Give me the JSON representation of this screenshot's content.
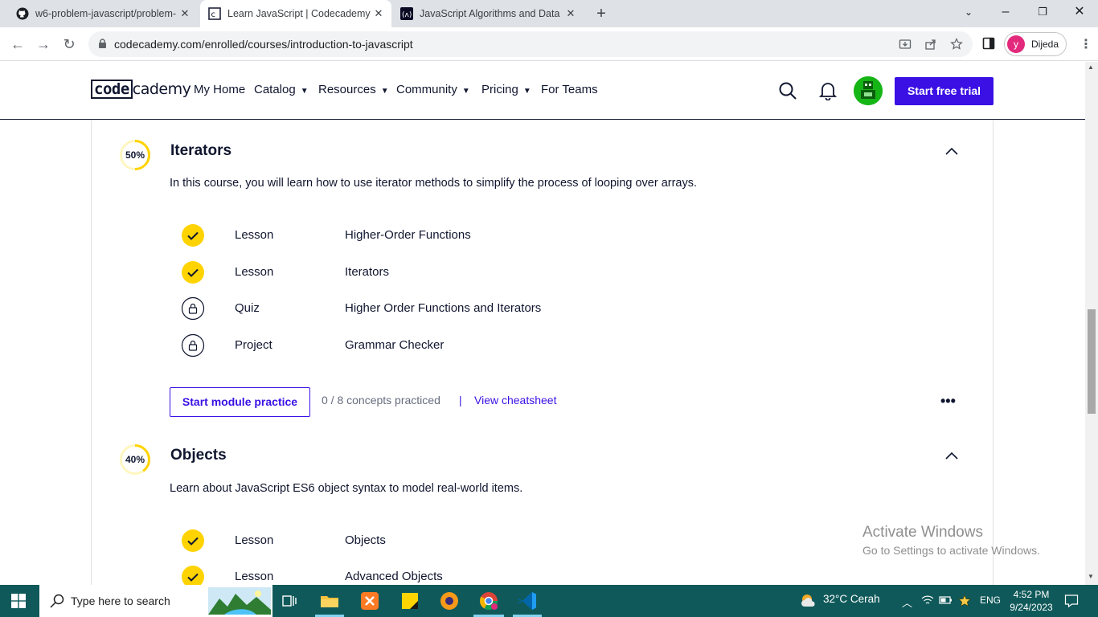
{
  "browser": {
    "tabs": [
      {
        "title": "w6-problem-javascript/problem-",
        "active": false
      },
      {
        "title": "Learn JavaScript | Codecademy",
        "active": true
      },
      {
        "title": "JavaScript Algorithms and Data S",
        "active": false
      }
    ],
    "url": "codecademy.com/enrolled/courses/introduction-to-javascript",
    "profile_initial": "y",
    "profile_name": "Dijeda"
  },
  "site": {
    "logo_left": "code",
    "logo_right": "cademy",
    "nav": [
      "My Home",
      "Catalog",
      "Resources",
      "Community",
      "Pricing",
      "For Teams"
    ],
    "cta": "Start free trial"
  },
  "modules": [
    {
      "progress": "50%",
      "progress_value": 50,
      "title": "Iterators",
      "description": "In this course, you will learn how to use iterator methods to simplify the process of looping over arrays.",
      "items": [
        {
          "kind": "Lesson",
          "name": "Higher-Order Functions",
          "status": "complete"
        },
        {
          "kind": "Lesson",
          "name": "Iterators",
          "status": "complete"
        },
        {
          "kind": "Quiz",
          "name": "Higher Order Functions and Iterators",
          "status": "locked"
        },
        {
          "kind": "Project",
          "name": "Grammar Checker",
          "status": "locked"
        }
      ],
      "practice_button": "Start module practice",
      "concepts": "0 / 8 concepts practiced",
      "separator": "|",
      "cheatsheet": "View cheatsheet",
      "more": "•••"
    },
    {
      "progress": "40%",
      "progress_value": 40,
      "title": "Objects",
      "description": "Learn about JavaScript ES6 object syntax to model real-world items.",
      "items": [
        {
          "kind": "Lesson",
          "name": "Objects",
          "status": "complete"
        },
        {
          "kind": "Lesson",
          "name": "Advanced Objects",
          "status": "complete"
        }
      ]
    }
  ],
  "watermark": {
    "line1": "Activate Windows",
    "line2": "Go to Settings to activate Windows."
  },
  "taskbar": {
    "search_placeholder": "Type here to search",
    "weather": "32°C  Cerah",
    "language": "ENG",
    "time": "4:52 PM",
    "date": "9/24/2023"
  },
  "colors": {
    "accent": "#3a10e5",
    "progress": "#ffd300",
    "taskbar": "#10595a"
  }
}
